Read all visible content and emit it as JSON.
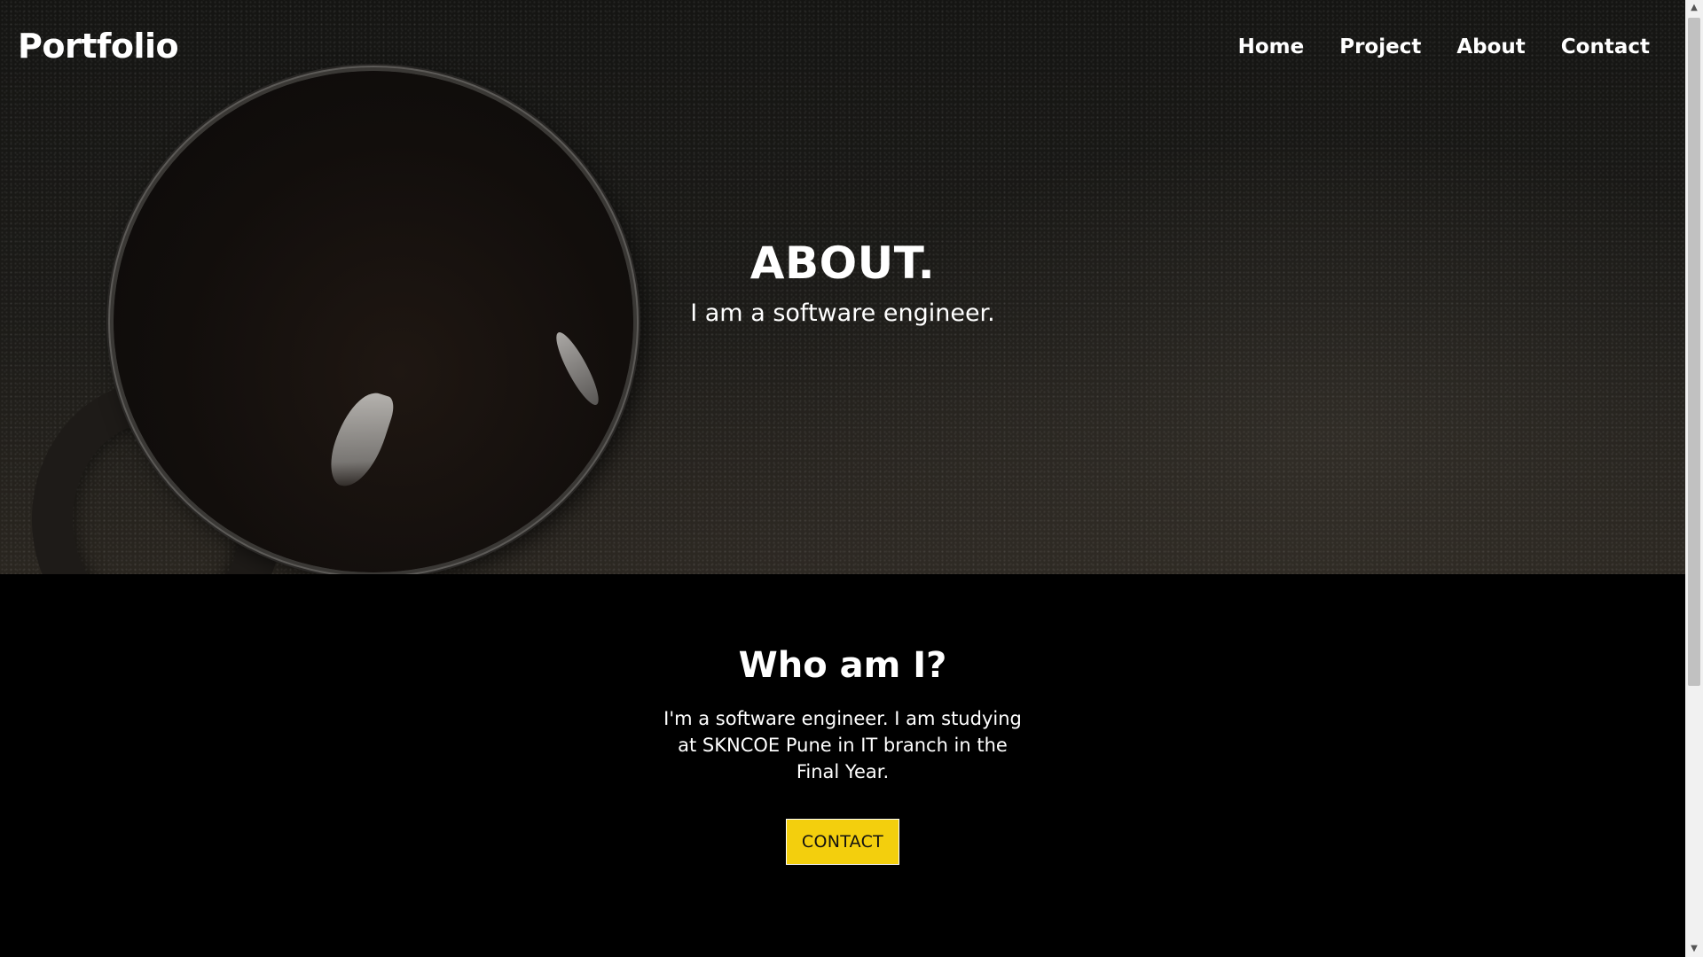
{
  "nav": {
    "logo": "Portfolio",
    "links": [
      "Home",
      "Project",
      "About",
      "Contact"
    ]
  },
  "hero": {
    "title": "ABOUT.",
    "subtitle": "I am a software engineer."
  },
  "about": {
    "heading": "Who am I?",
    "text": "I'm a software engineer. I am studying at SKNCOE Pune in IT branch in the Final Year.",
    "button_label": "CONTACT"
  },
  "colors": {
    "accent": "#f3cf0d",
    "background": "#000000",
    "text": "#ffffff"
  },
  "icons": {
    "scroll_up": "triangle-up-icon",
    "scroll_down": "triangle-down-icon"
  }
}
